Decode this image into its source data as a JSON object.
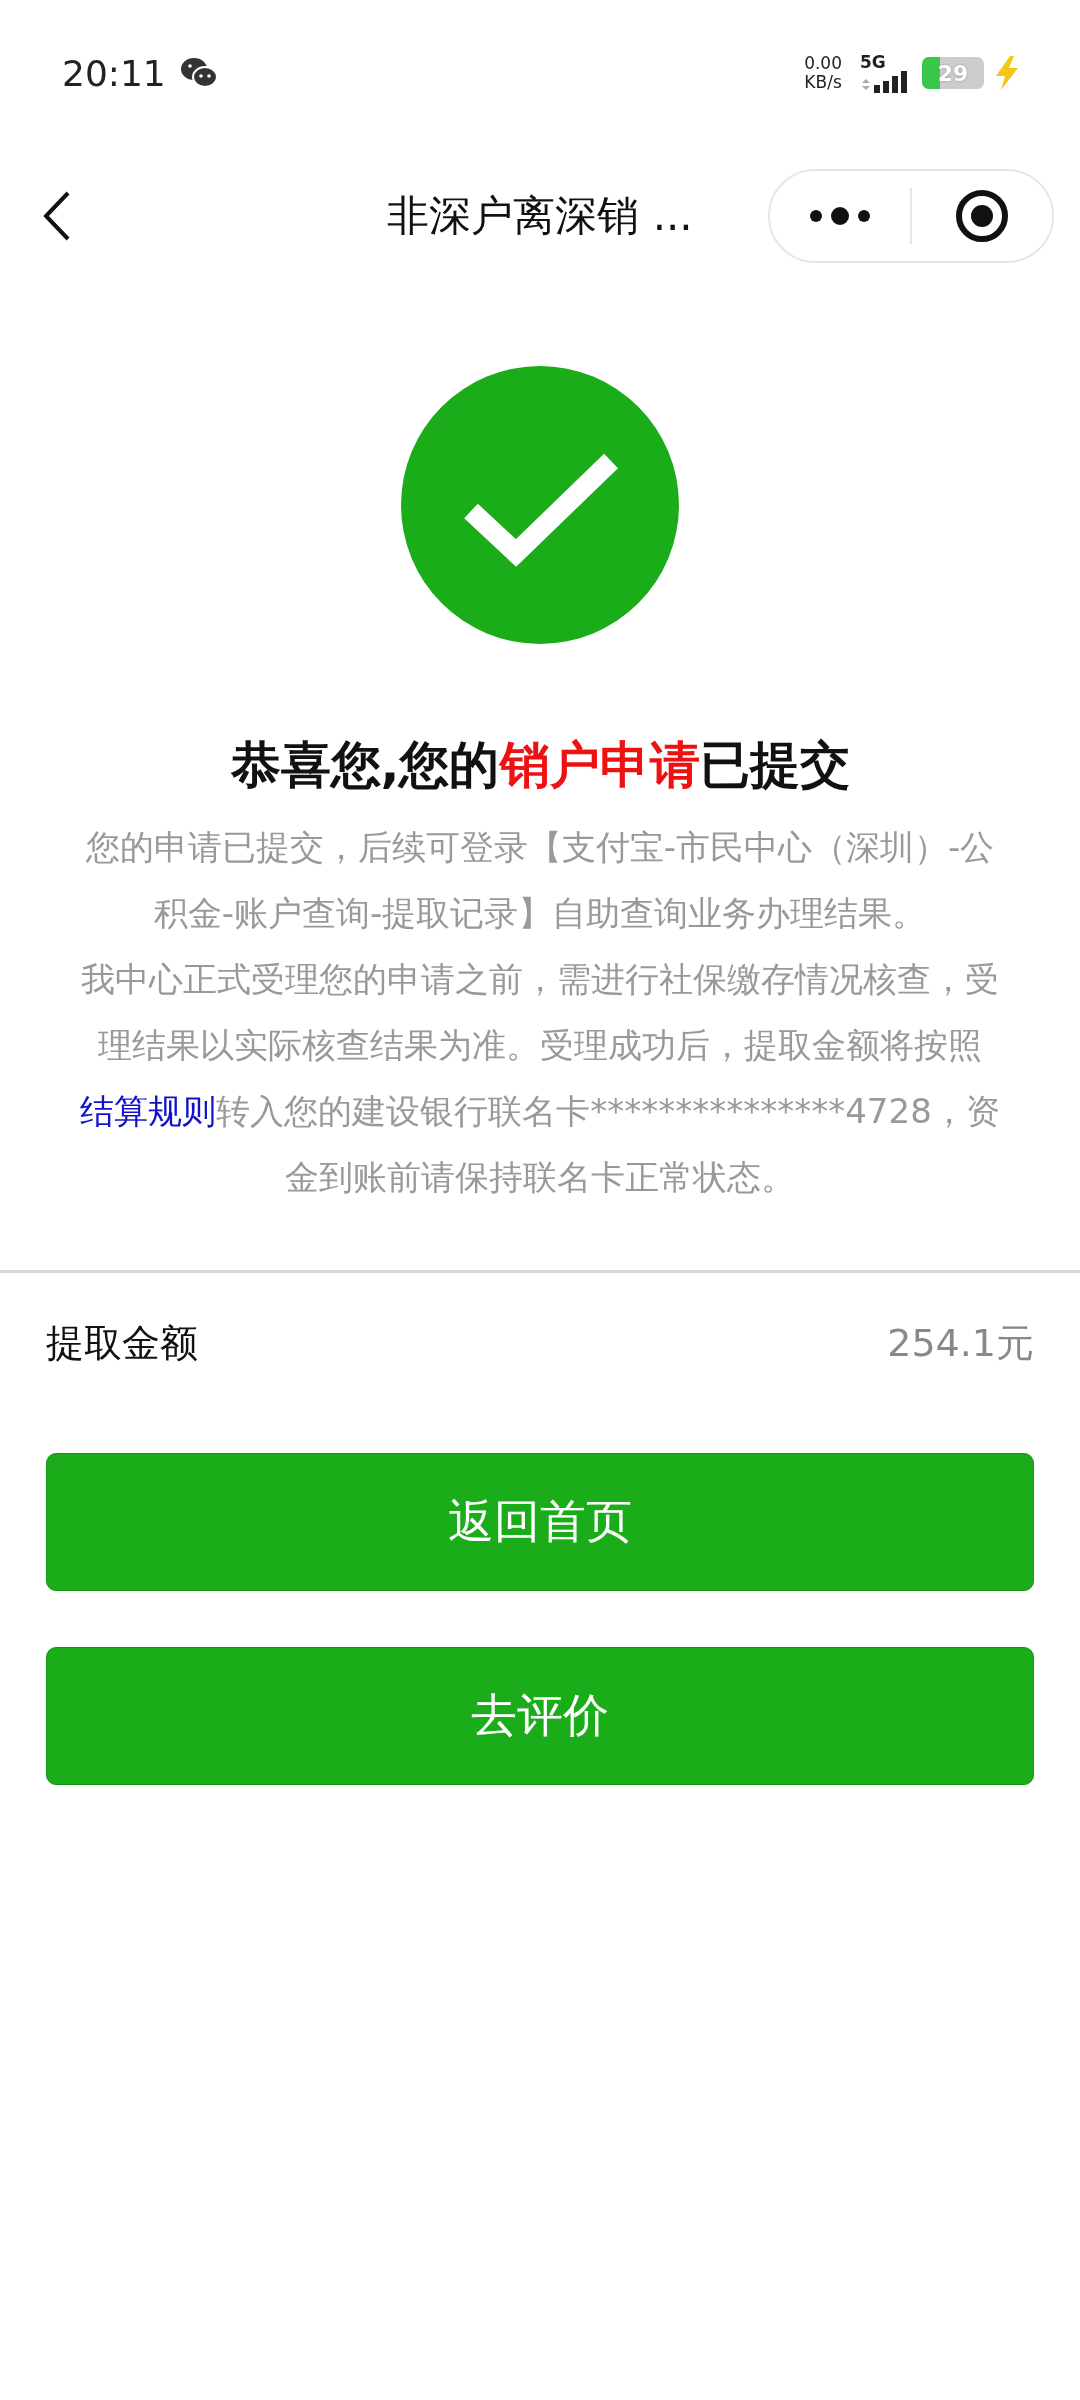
{
  "status_bar": {
    "time": "20:11",
    "net_speed": "0.00",
    "net_unit": "KB/s",
    "network": "5G",
    "battery": "29",
    "charging": true
  },
  "nav": {
    "title": "非深户离深销 ..."
  },
  "result": {
    "title_parts": [
      {
        "kind": "plain",
        "text": "恭喜您,您的"
      },
      {
        "kind": "highlight",
        "text": "销户申请"
      },
      {
        "kind": "plain",
        "text": "已提交"
      }
    ],
    "notice_1": "您的申请已提交，后续可登录【支付宝-市民中心（深圳）-公积金-账户查询-提取记录】自助查询业务办理结果。",
    "notice_2_parts": [
      {
        "kind": "plain",
        "text": "我中心正式受理您的申请之前，需进行社保缴存情况核查，受理结果以实际核查结果为准。受理成功后，提取金额将按照"
      },
      {
        "kind": "link",
        "text": "结算规则"
      },
      {
        "kind": "plain",
        "text": "转入您的建设银行联名卡***************4728，资金到账前请保持联名卡正常状态。"
      }
    ]
  },
  "amount": {
    "label": "提取金额",
    "value": "254.1元"
  },
  "buttons": [
    "返回首页",
    "去评价"
  ]
}
